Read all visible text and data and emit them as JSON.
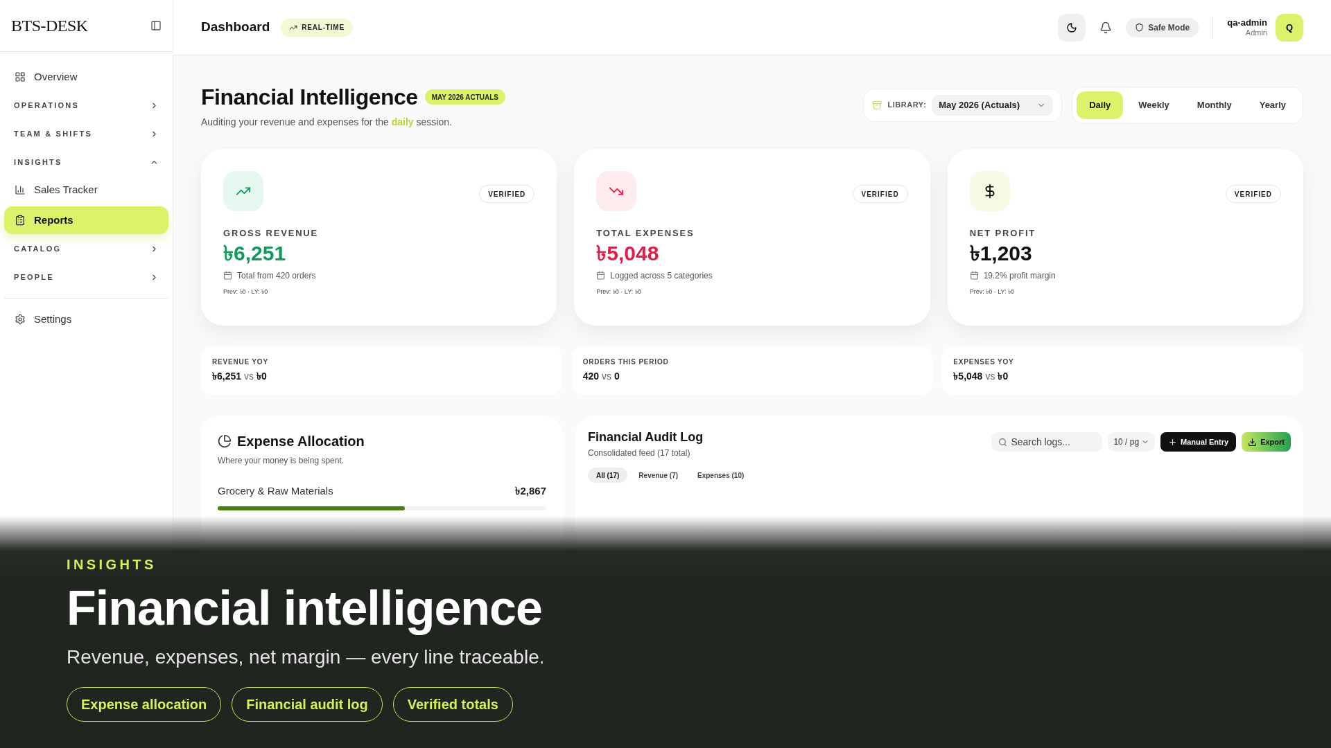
{
  "sidebar": {
    "logo": "BTS-DESK",
    "items": [
      {
        "kind": "link",
        "label": "Overview",
        "selected": false
      },
      {
        "kind": "section",
        "label": "OPERATIONS",
        "expanded": false
      },
      {
        "kind": "section",
        "label": "TEAM & SHIFTS",
        "expanded": false
      },
      {
        "kind": "section",
        "label": "INSIGHTS",
        "expanded": true,
        "children": [
          {
            "kind": "link",
            "label": "Sales Tracker",
            "selected": false
          },
          {
            "kind": "link",
            "label": "Reports",
            "selected": true
          }
        ]
      },
      {
        "kind": "section",
        "label": "CATALOG",
        "expanded": false
      },
      {
        "kind": "section",
        "label": "PEOPLE",
        "expanded": false
      }
    ],
    "footer_items": [
      {
        "kind": "link",
        "label": "Settings",
        "selected": false
      }
    ]
  },
  "header": {
    "title": "Dashboard",
    "badge": "REAL-TIME",
    "safe_mode": "Safe Mode",
    "user": {
      "name": "qa-admin",
      "role": "Admin",
      "initial": "Q"
    }
  },
  "page": {
    "title": "Financial Intelligence",
    "badge": "MAY 2026 ACTUALS",
    "subtitle": "Auditing your revenue and expenses for the **daily** session.",
    "library": {
      "label": "LIBRARY:",
      "value": "May 2026 (Actuals)"
    },
    "periods": [
      {
        "label": "Daily",
        "selected": true
      },
      {
        "label": "Weekly",
        "selected": false
      },
      {
        "label": "Monthly",
        "selected": false
      },
      {
        "label": "Yearly",
        "selected": false
      }
    ]
  },
  "cards": [
    {
      "kind": "revenue",
      "badge": "VERIFIED",
      "label": "GROSS REVENUE",
      "value": "৳6,251",
      "note": "Total from 420 orders",
      "prev": "Prev: ৳0 · LY: ৳0"
    },
    {
      "kind": "expense",
      "badge": "VERIFIED",
      "label": "TOTAL EXPENSES",
      "value": "৳5,048",
      "note": "Logged across 5 categories",
      "prev": "Prev: ৳0 · LY: ৳0"
    },
    {
      "kind": "profit",
      "badge": "VERIFIED",
      "label": "NET PROFIT",
      "value": "৳1,203",
      "note": "19.2% profit margin",
      "prev": "Prev: ৳0 · LY: ৳0"
    }
  ],
  "stats": [
    {
      "label": "REVENUE YOY",
      "value": "৳6,251",
      "vs": "vs",
      "compare": "৳0"
    },
    {
      "label": "ORDERS THIS PERIOD",
      "value": "420",
      "vs": "vs",
      "compare": "0"
    },
    {
      "label": "EXPENSES YOY",
      "value": "৳5,048",
      "vs": "vs",
      "compare": "৳0"
    }
  ],
  "expense_allocation": {
    "title": "Expense Allocation",
    "subtitle": "Where your money is being spent.",
    "items": [
      {
        "name": "Grocery & Raw Materials",
        "amount": "৳2,867",
        "level": 0.57
      }
    ]
  },
  "audit_log": {
    "title": "Financial Audit Log",
    "subtitle": "Consolidated feed (17 total)",
    "search_placeholder": "Search logs...",
    "page_size": "10 / pg",
    "manual_entry": "Manual Entry",
    "export": "Export",
    "filters": [
      {
        "label": "All (17)",
        "selected": true
      },
      {
        "label": "Revenue (7)",
        "selected": false
      },
      {
        "label": "Expenses (10)",
        "selected": false
      }
    ]
  },
  "hero": {
    "eyebrow": "INSIGHTS",
    "title": "Financial intelligence",
    "subtitle": "Revenue, expenses, net margin — every line traceable.",
    "pills": [
      "Expense allocation",
      "Financial audit log",
      "Verified totals"
    ]
  }
}
